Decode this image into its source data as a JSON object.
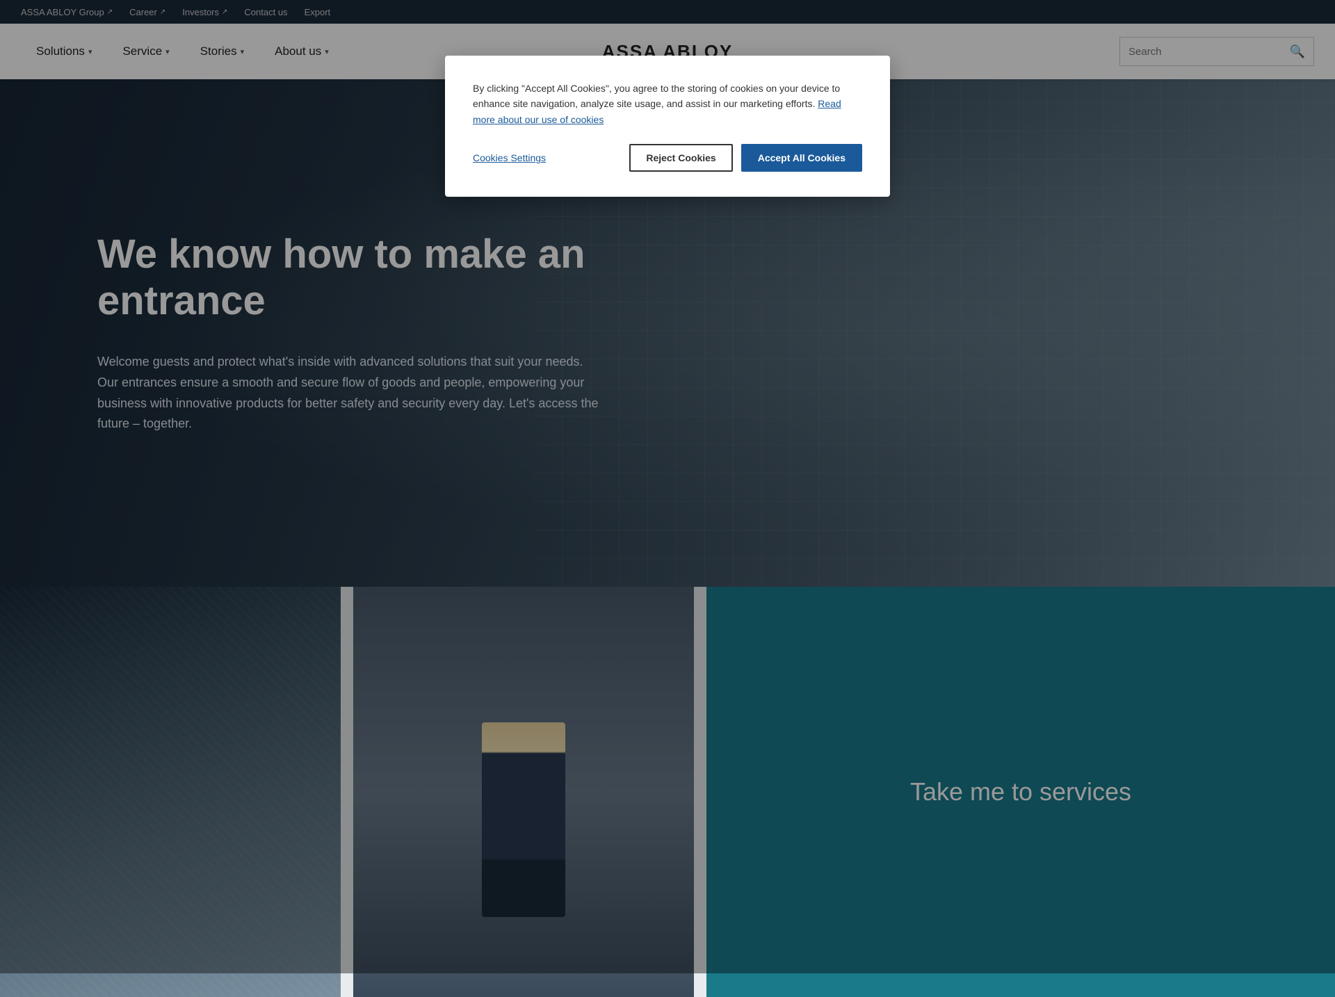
{
  "topbar": {
    "items": [
      {
        "id": "assa-abloy-group",
        "label": "ASSA ABLOY Group",
        "external": true
      },
      {
        "id": "career",
        "label": "Career",
        "external": true
      },
      {
        "id": "investors",
        "label": "Investors",
        "external": true
      },
      {
        "id": "contact-us",
        "label": "Contact us",
        "external": false
      },
      {
        "id": "export",
        "label": "Export",
        "external": false
      }
    ]
  },
  "nav": {
    "logo": "ASSA ABLOY",
    "links": [
      {
        "id": "solutions",
        "label": "Solutions",
        "hasDropdown": true
      },
      {
        "id": "service",
        "label": "Service",
        "hasDropdown": true
      },
      {
        "id": "stories",
        "label": "Stories",
        "hasDropdown": true
      },
      {
        "id": "about-us",
        "label": "About us",
        "hasDropdown": true
      }
    ],
    "search_placeholder": "Search"
  },
  "hero": {
    "title": "We know how to make an entrance",
    "description": "Welcome guests and protect what's inside with advanced solutions that suit your needs. Our entrances ensure a smooth and secure flow of goods and people, empowering your business with innovative products for better safety and security every day. Let's access the future – together."
  },
  "cards": {
    "services_label": "Take me to services"
  },
  "cookie": {
    "description_before": "By clicking \"Accept All Cookies\", you agree to the storing of cookies on your device to enhance site navigation, analyze site usage, and assist in our marketing efforts. ",
    "link_text": "Read more about our use of cookies",
    "settings_label": "Cookies Settings",
    "reject_label": "Reject Cookies",
    "accept_label": "Accept All Cookies"
  },
  "colors": {
    "topbar_bg": "#1a2a3a",
    "nav_bg": "#ffffff",
    "hero_overlay": "rgba(20,35,50,0.75)",
    "services_card": "#1a7a8a",
    "accept_btn": "#1a5a9a"
  }
}
